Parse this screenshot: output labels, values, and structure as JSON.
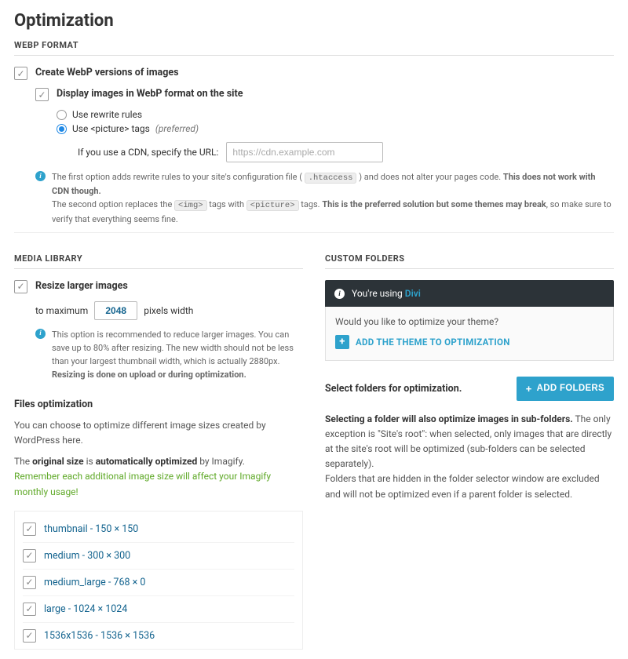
{
  "page_title": "Optimization",
  "webp": {
    "section": "WEBP FORMAT",
    "create_versions": "Create WebP versions of images",
    "display_on_site": "Display images in WebP format on the site",
    "radio_rewrite": "Use rewrite rules",
    "radio_picture": "Use <picture> tags",
    "preferred": "(preferred)",
    "cdn_label": "If you use a CDN, specify the URL:",
    "cdn_placeholder": "https://cdn.example.com",
    "info_1a": "The first option adds rewrite rules to your site's configuration file (",
    "info_1_code": ".htaccess",
    "info_1b": ") and does not alter your pages code.",
    "info_1_bold": "This does not work with CDN though.",
    "info_2a": "The second option replaces the",
    "info_2_code1": "<img>",
    "info_2b": "tags with",
    "info_2_code2": "<picture>",
    "info_2c": "tags.",
    "info_2_bold": "This is the preferred solution but some themes may break",
    "info_2d": ", so make sure to verify that everything seems fine."
  },
  "media_library": {
    "section": "MEDIA LIBRARY",
    "resize_label": "Resize larger images",
    "to_maximum": "to maximum",
    "width_value": "2048",
    "pixels_width": "pixels width",
    "info_a": "This option is recommended to reduce larger images. You can save up to 80% after resizing. The new width should not be less than your largest thumbnail width, which is actually 2880px.",
    "info_bold": "Resizing is done on upload or during optimization."
  },
  "files": {
    "heading": "Files optimization",
    "line1": "You can choose to optimize different image sizes created by WordPress here.",
    "line2a": "The",
    "line2_bold1": "original size",
    "line2b": "is",
    "line2_bold2": "automatically optimized",
    "line2c": "by Imagify.",
    "green": "Remember each additional image size will affect your Imagify monthly usage!",
    "sizes": [
      "thumbnail - 150 × 150",
      "medium - 300 × 300",
      "medium_large - 768 × 0",
      "large - 1024 × 1024",
      "1536x1536 - 1536 × 1536"
    ]
  },
  "custom": {
    "section": "CUSTOM FOLDERS",
    "using": "You're using",
    "theme_name": "Divi",
    "question": "Would you like to optimize your theme?",
    "add_theme": "ADD THE THEME TO OPTIMIZATION",
    "select_folders": "Select folders for optimization.",
    "add_folders": "ADD FOLDERS",
    "desc_bold": "Selecting a folder will also optimize images in sub-folders.",
    "desc_1": " The only exception is \"Site's root\": when selected, only images that are directly at the site's root will be optimized (sub-folders can be selected separately).",
    "desc_2": "Folders that are hidden in the folder selector window are excluded and will not be optimized even if a parent folder is selected."
  }
}
